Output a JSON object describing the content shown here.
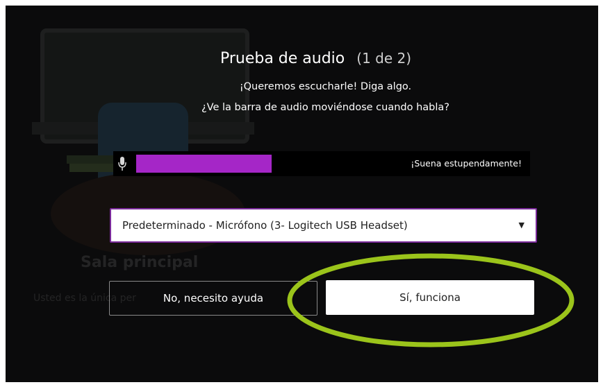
{
  "dialog": {
    "title": "Prueba de audio",
    "step": "(1 de 2)",
    "line1": "¡Queremos escucharle! Diga algo.",
    "line2": "¿Ve la barra de audio moviéndose cuando habla?"
  },
  "meter": {
    "icon": "microphone-icon",
    "level": 0.53,
    "status": "¡Suena estupendamente!",
    "color": "#a526c7"
  },
  "mic_select": {
    "value": "Predeterminado - Micrófono (3- Logitech USB Headset)",
    "caret": "▼"
  },
  "buttons": {
    "no_label": "No, necesito ayuda",
    "yes_label": "Sí, funciona"
  },
  "background": {
    "room_title": "Sala principal",
    "room_sub": "Usted es la única per"
  },
  "colors": {
    "highlight": "#9bc41b",
    "accent": "#7a2a9a"
  }
}
